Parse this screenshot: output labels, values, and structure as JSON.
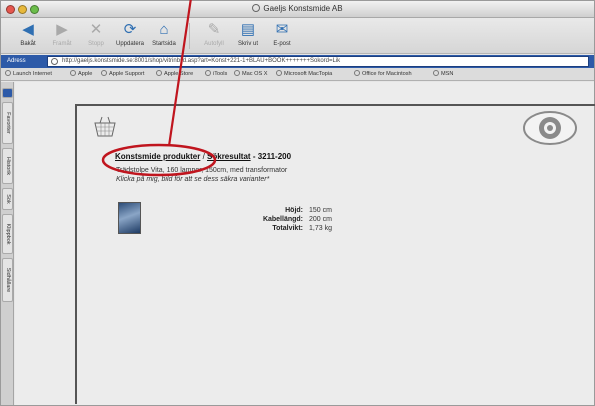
{
  "window": {
    "title": "Gaeljs Konstsmide AB"
  },
  "toolbar": {
    "buttons": [
      {
        "label": "Bakåt",
        "icon": "back-arrow-icon"
      },
      {
        "label": "Framåt",
        "icon": "forward-arrow-icon"
      },
      {
        "label": "Stopp",
        "icon": "stop-icon"
      },
      {
        "label": "Uppdatera",
        "icon": "refresh-icon"
      },
      {
        "label": "Startsida",
        "icon": "home-icon"
      },
      {
        "label": "Autofyll",
        "icon": "autofill-icon"
      },
      {
        "label": "Skriv ut",
        "icon": "print-icon"
      },
      {
        "label": "E-post",
        "icon": "mail-icon"
      }
    ]
  },
  "address": {
    "label": "Adress",
    "url": "http://gaeljs.konstsmide.se:8001/shop/vitrinbild.asp?art=Konst+221-1+BLAU+BOOK+++++++Sokord=Lik"
  },
  "favorites": [
    "Launch Internet",
    "Apple",
    "Apple Support",
    "Apple Store",
    "iTools",
    "Mac OS X",
    "Microsoft MacTopia",
    "Office for Macintosh",
    "MSN"
  ],
  "sidebar_tabs": [
    "Favoriter",
    "Historik",
    "Sök",
    "Klippbok",
    "Sidhållare"
  ],
  "product": {
    "breadcrumb_1": "Konstsmide produkter",
    "separator": " / ",
    "breadcrumb_2": "Sökresultat",
    "code": " - 3211-200",
    "description": "Trädstolpe Vita, 160 lampor, 150cm, med transformator",
    "note": "Klicka på mig, bild för att se dess säkra varianter*",
    "specs": [
      {
        "key": "Höjd:",
        "value": "150 cm"
      },
      {
        "key": "Kabellängd:",
        "value": "200 cm"
      },
      {
        "key": "Totalvikt:",
        "value": "1,73 kg"
      }
    ]
  },
  "colors": {
    "accent": "#2d5aa8",
    "annotation": "#c0151e"
  }
}
